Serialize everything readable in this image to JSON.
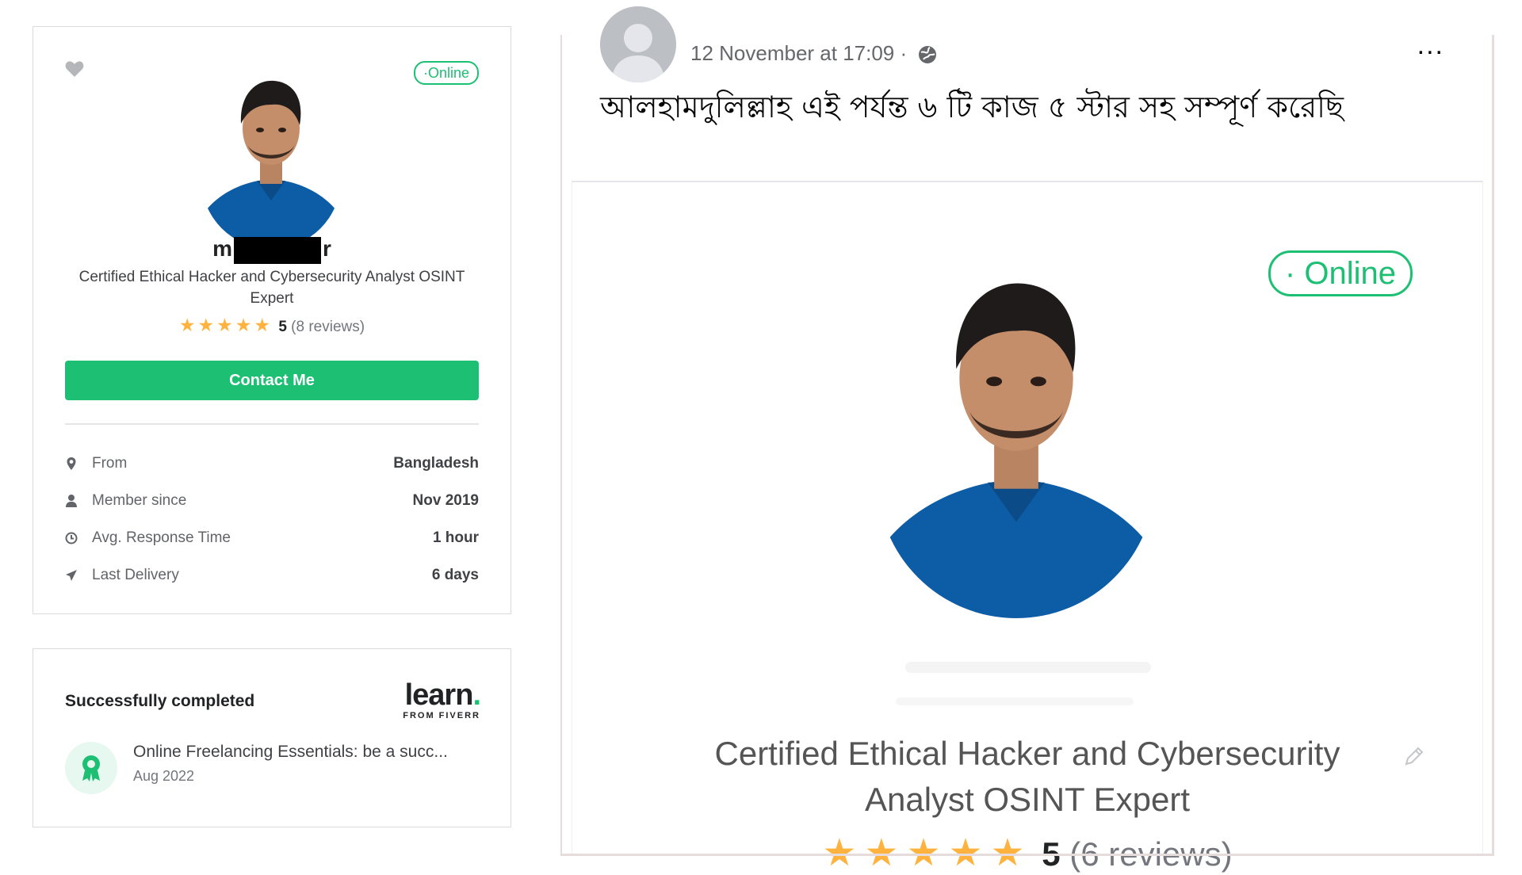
{
  "profile_card": {
    "status": "Online",
    "name_start": "m",
    "name_end": "r",
    "tagline": "Certified Ethical Hacker and Cybersecurity Analyst OSINT Expert",
    "rating_score": "5",
    "rating_count": "(8 reviews)",
    "rating_stars": 5,
    "contact_label": "Contact Me",
    "stats": [
      {
        "icon": "location-pin-icon",
        "label": "From",
        "value": "Bangladesh"
      },
      {
        "icon": "user-icon",
        "label": "Member since",
        "value": "Nov 2019"
      },
      {
        "icon": "clock-icon",
        "label": "Avg. Response Time",
        "value": "1 hour"
      },
      {
        "icon": "paper-plane-icon",
        "label": "Last Delivery",
        "value": "6 days"
      }
    ]
  },
  "learn_card": {
    "title": "Successfully completed",
    "logo_word": "learn",
    "logo_dot": ".",
    "logo_sub": "FROM FIVERR",
    "course_title": "Online Freelancing Essentials: be a succ...",
    "course_date": "Aug 2022"
  },
  "post": {
    "timestamp": "12 November at 17:09 ·",
    "more": "...",
    "text": "আলহামদুলিল্লাহ এই পর্যন্ত ৬ টি কাজ ৫ স্টার সহ সম্পূর্ণ করেছি",
    "image": {
      "status": "Online",
      "tagline_line1": "Certified Ethical Hacker and Cybersecurity",
      "tagline_line2": "Analyst OSINT Expert",
      "rating_score": "5",
      "rating_count": "(6 reviews)",
      "rating_stars": 5
    }
  },
  "colors": {
    "accent_green": "#1dbf73",
    "star_gold": "#ffb33e",
    "text_dark": "#222325",
    "text_muted": "#74767e"
  }
}
